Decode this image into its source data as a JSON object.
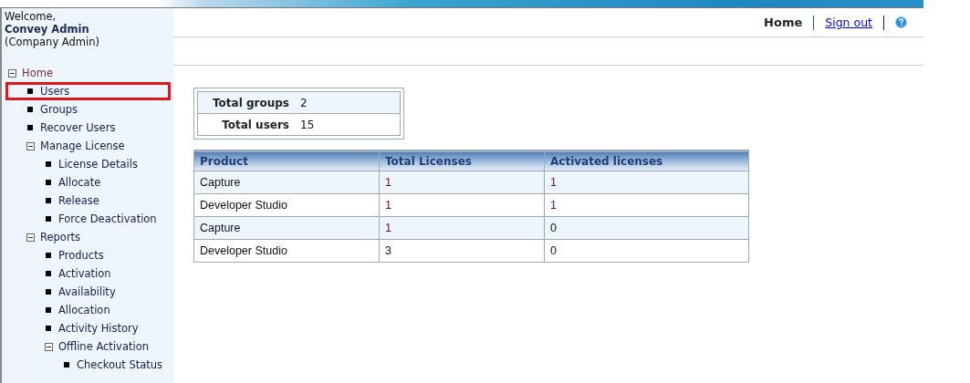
{
  "welcome": {
    "greeting": "Welcome,",
    "name": "Convey Admin",
    "role": "(Company Admin)"
  },
  "nav": [
    {
      "label": "Home",
      "expanded": true,
      "highlighted": false,
      "children": [
        {
          "label": "Users",
          "highlighted": true
        },
        {
          "label": "Groups",
          "highlighted": false
        },
        {
          "label": "Recover Users",
          "highlighted": false
        },
        {
          "label": "Manage License",
          "expanded": true,
          "highlighted": false,
          "children": [
            {
              "label": "License Details",
              "highlighted": false
            },
            {
              "label": "Allocate",
              "highlighted": false
            },
            {
              "label": "Release",
              "highlighted": false
            },
            {
              "label": "Force Deactivation",
              "highlighted": false
            }
          ]
        },
        {
          "label": "Reports",
          "expanded": true,
          "highlighted": false,
          "children": [
            {
              "label": "Products",
              "highlighted": false
            },
            {
              "label": "Activation",
              "highlighted": false
            },
            {
              "label": "Availability",
              "highlighted": false
            },
            {
              "label": "Allocation",
              "highlighted": false
            },
            {
              "label": "Activity History",
              "highlighted": false
            },
            {
              "label": "Offline Activation",
              "expanded": true,
              "highlighted": false,
              "children": [
                {
                  "label": "Checkout Status",
                  "highlighted": false
                }
              ]
            }
          ]
        }
      ]
    }
  ],
  "header": {
    "home": "Home",
    "sign_out": "Sign out"
  },
  "summary": [
    {
      "label": "Total groups",
      "value": "2"
    },
    {
      "label": "Total users",
      "value": "15"
    }
  ],
  "table": {
    "columns": [
      "Product",
      "Total Licenses",
      "Activated licenses"
    ],
    "rows": [
      [
        {
          "text": "Capture",
          "link": false
        },
        {
          "text": "1",
          "link": true
        },
        {
          "text": "1",
          "link": true
        }
      ],
      [
        {
          "text": "Developer Studio",
          "link": false
        },
        {
          "text": "1",
          "link": true
        },
        {
          "text": "1",
          "link": true
        }
      ],
      [
        {
          "text": "Capture",
          "link": false
        },
        {
          "text": "1",
          "link": true
        },
        {
          "text": "0",
          "link": false
        }
      ],
      [
        {
          "text": "Developer Studio",
          "link": false
        },
        {
          "text": "3",
          "link": false
        },
        {
          "text": "0",
          "link": false
        }
      ]
    ]
  }
}
